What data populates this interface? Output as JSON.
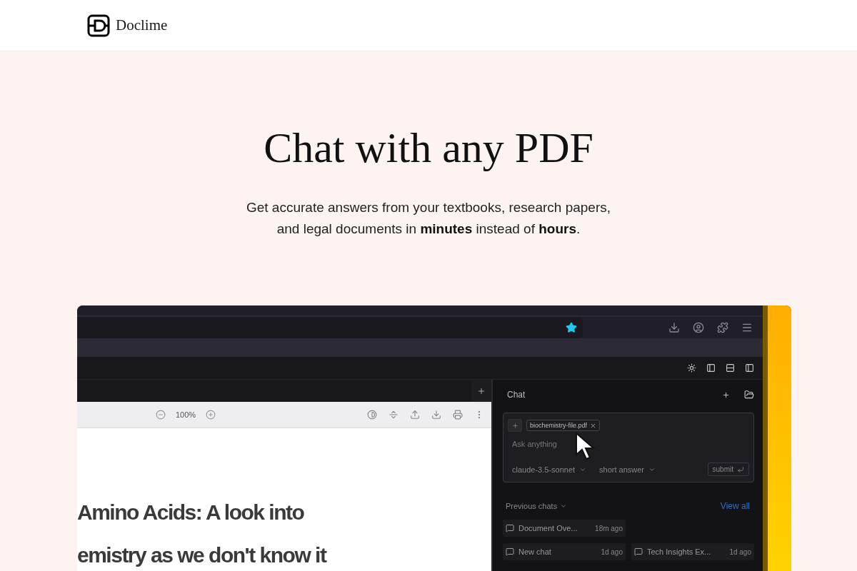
{
  "header": {
    "brand": "Doclime"
  },
  "hero": {
    "title": "Chat with any PDF",
    "subtitle": "Get accurate answers from your textbooks, research papers, and legal documents in **minutes** instead of **hours**."
  },
  "preview": {
    "zoom": "100%",
    "document_lines": [
      "Amino Acids: A look into",
      "emistry as we don't know it"
    ],
    "chat": {
      "title": "Chat",
      "attachment": "biochemistry-file.pdf",
      "placeholder": "Ask anything",
      "model": "claude-3.5-sonnet",
      "answer_mode": "short answer",
      "submit": "submit",
      "previous_label": "Previous chats",
      "view_all": "View all",
      "chat_rows": [
        [
          {
            "title": "Document Ove...",
            "time": "18m ago"
          }
        ],
        [
          {
            "title": "New chat",
            "time": "1d ago"
          },
          {
            "title": "Tech Insights Ex...",
            "time": "1d ago"
          }
        ]
      ]
    }
  }
}
